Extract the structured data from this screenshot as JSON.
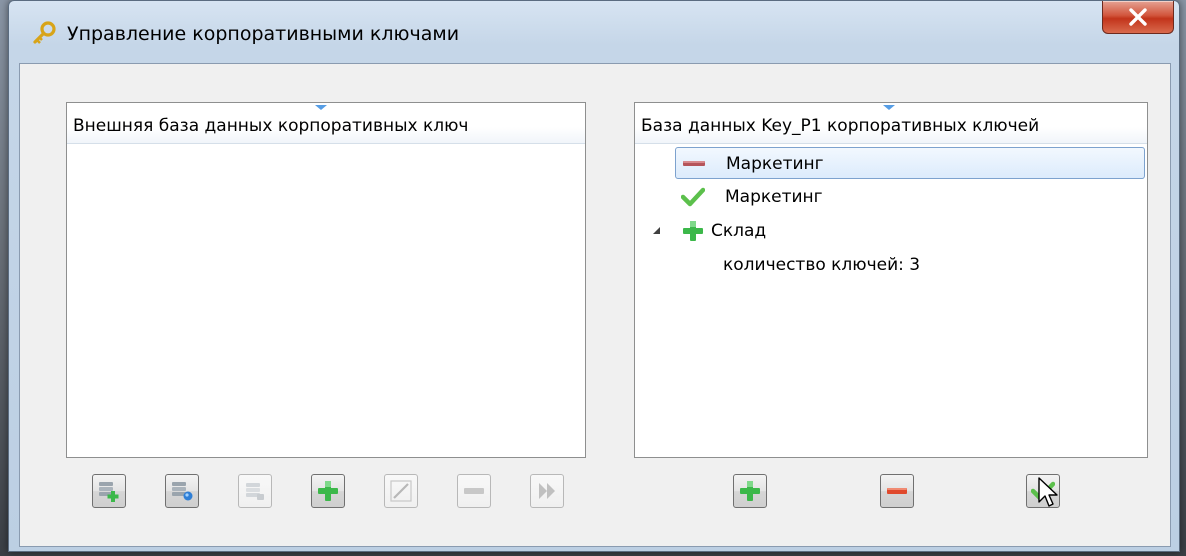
{
  "window": {
    "title": "Управление корпоративными ключами",
    "title_icon": "key-icon",
    "close_icon": "close-icon"
  },
  "left_panel": {
    "header": "Внешняя база данных корпоративных ключ",
    "items": [],
    "toolbar": [
      {
        "name": "add-database-button",
        "icon": "database-add-icon",
        "enabled": true
      },
      {
        "name": "connect-database-button",
        "icon": "database-connect-icon",
        "enabled": true
      },
      {
        "name": "database-properties-button",
        "icon": "database-icon",
        "enabled": false
      },
      {
        "name": "add-key-button",
        "icon": "plus-icon",
        "enabled": true
      },
      {
        "name": "edit-key-button",
        "icon": "pencil-icon",
        "enabled": false
      },
      {
        "name": "remove-key-button",
        "icon": "minus-icon",
        "enabled": false
      },
      {
        "name": "transfer-button",
        "icon": "forward-icon",
        "enabled": false
      }
    ]
  },
  "right_panel": {
    "header": "База данных Key_P1 корпоративных ключей",
    "items": [
      {
        "label": "Маркетинг",
        "icon": "minus-icon",
        "selected": true
      },
      {
        "label": "Маркетинг",
        "icon": "check-icon",
        "selected": false
      },
      {
        "label": "Склад",
        "icon": "plus-icon",
        "selected": false,
        "expanded": true
      },
      {
        "label": "количество ключей: 3",
        "icon": "",
        "selected": false
      }
    ],
    "toolbar": [
      {
        "name": "add-button",
        "icon": "plus-icon",
        "enabled": true
      },
      {
        "name": "remove-button",
        "icon": "minus-icon",
        "enabled": true
      },
      {
        "name": "apply-button",
        "icon": "check-icon",
        "enabled": true
      }
    ]
  },
  "colors": {
    "accent_blue": "#569de5",
    "plus_green": "#3cb84a",
    "minus_red": "#e0492c",
    "check_green": "#5cc04c"
  }
}
